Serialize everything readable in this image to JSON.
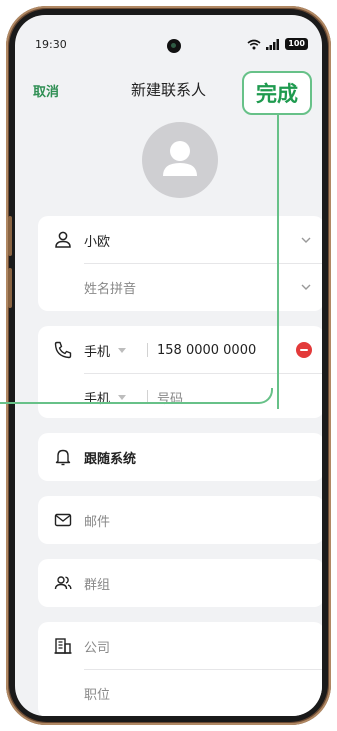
{
  "status_bar": {
    "time": "19:30",
    "battery": "100"
  },
  "header": {
    "cancel_label": "取消",
    "title": "新建联系人",
    "done_label": "完成"
  },
  "name_card": {
    "name_value": "小欧",
    "pinyin_placeholder": "姓名拼音"
  },
  "phone_card": {
    "rows": [
      {
        "type": "手机",
        "number": "158 0000 0000"
      },
      {
        "type": "手机",
        "number_placeholder": "号码"
      }
    ]
  },
  "ringtone": {
    "label": "跟随系统"
  },
  "email": {
    "placeholder": "邮件"
  },
  "group": {
    "placeholder": "群组"
  },
  "company_card": {
    "company_placeholder": "公司",
    "position_placeholder": "职位"
  },
  "colors": {
    "accent_green": "#2f8f53",
    "highlight_green": "#67c188",
    "delete_red": "#e33a3a"
  }
}
